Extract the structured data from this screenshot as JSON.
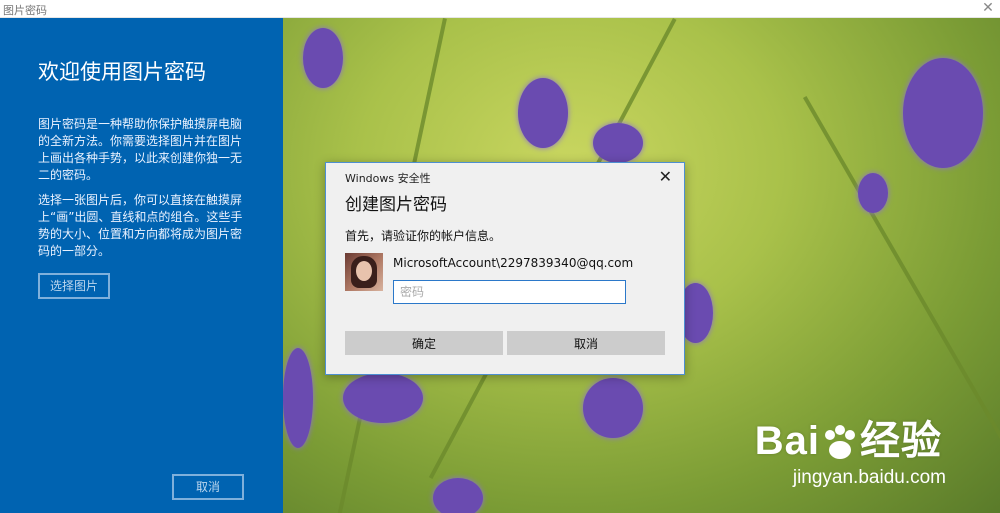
{
  "window": {
    "title": "图片密码"
  },
  "left_panel": {
    "heading": "欢迎使用图片密码",
    "para1": "图片密码是一种帮助你保护触摸屏电脑的全新方法。你需要选择图片并在图片上画出各种手势，以此来创建你独一无二的密码。",
    "para2": "选择一张图片后，你可以直接在触摸屏上“画”出圆、直线和点的组合。这些手势的大小、位置和方向都将成为图片密码的一部分。",
    "choose_button": "选择图片",
    "cancel_button": "取消"
  },
  "dialog": {
    "title": "Windows 安全性",
    "heading": "创建图片密码",
    "prompt": "首先，请验证你的帐户信息。",
    "account": "MicrosoftAccount\\2297839340@qq.com",
    "password_placeholder": "密码",
    "password_value": "",
    "ok_button": "确定",
    "cancel_button": "取消"
  },
  "watermark": {
    "logo_text": "Bai",
    "logo_text2": "经验",
    "sub": "jingyan.baidu.com"
  },
  "colors": {
    "panel_blue": "#0063b1",
    "dialog_border": "#4d8fd1",
    "flower_purple": "#6a4bb0"
  }
}
